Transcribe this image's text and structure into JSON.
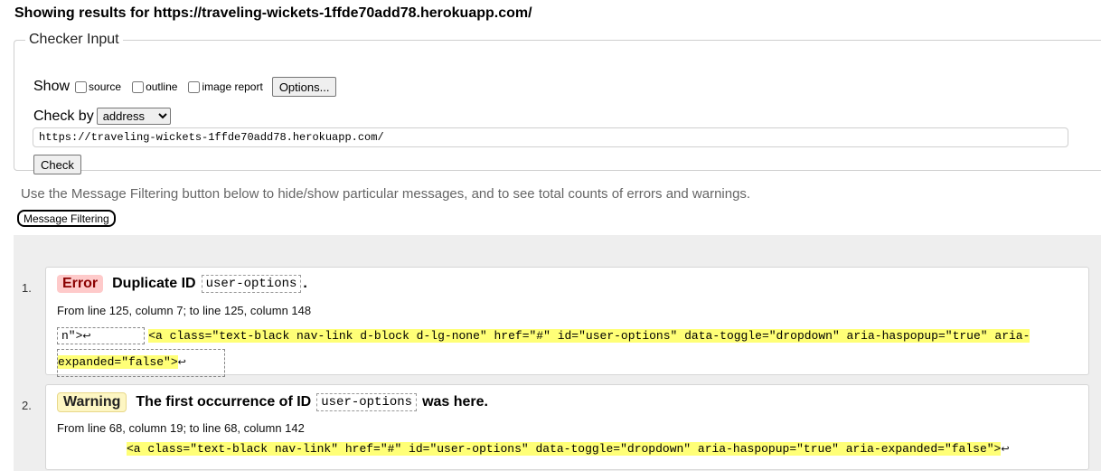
{
  "header": {
    "title": "Showing results for https://traveling-wickets-1ffde70add78.herokuapp.com/"
  },
  "checker": {
    "legend": "Checker Input",
    "show_label": "Show",
    "checkboxes": [
      {
        "label": "source",
        "checked": false
      },
      {
        "label": "outline",
        "checked": false
      },
      {
        "label": "image report",
        "checked": false
      }
    ],
    "options_button": "Options...",
    "check_by_label": "Check by",
    "check_by_value": "address",
    "url_value": "https://traveling-wickets-1ffde70add78.herokuapp.com/",
    "check_button": "Check"
  },
  "filter": {
    "hint": "Use the Message Filtering button below to hide/show particular messages, and to see total counts of errors and warnings.",
    "button": "Message Filtering"
  },
  "messages": [
    {
      "num": "1.",
      "type": "Error",
      "text_before": "Duplicate ID",
      "code": "user-options",
      "text_after": ".",
      "location": "From line 125, column 7; to line 125, column 148",
      "extract_lead": "n\">",
      "extract_line1": "<a class=\"text-black nav-link d-block d-lg-none\" href=\"#\" id=\"user-options\" data-toggle=\"dropdown\" aria-haspopup=\"true\" aria-",
      "extract_line2": "expanded=\"false\">"
    },
    {
      "num": "2.",
      "type": "Warning",
      "text_before": "The first occurrence of ID",
      "code": "user-options",
      "text_after": "was here.",
      "location": "From line 68, column 19; to line 68, column 142",
      "extract_line1": "<a class=\"text-black nav-link\" href=\"#\" id=\"user-options\" data-toggle=\"dropdown\" aria-haspopup=\"true\" aria-expanded=\"false\">"
    }
  ],
  "icons": {
    "return": "return-arrow-icon"
  },
  "colors": {
    "error_badge": "#fecaca",
    "warning_badge": "#fdf6c3",
    "highlight": "#ffff77"
  }
}
